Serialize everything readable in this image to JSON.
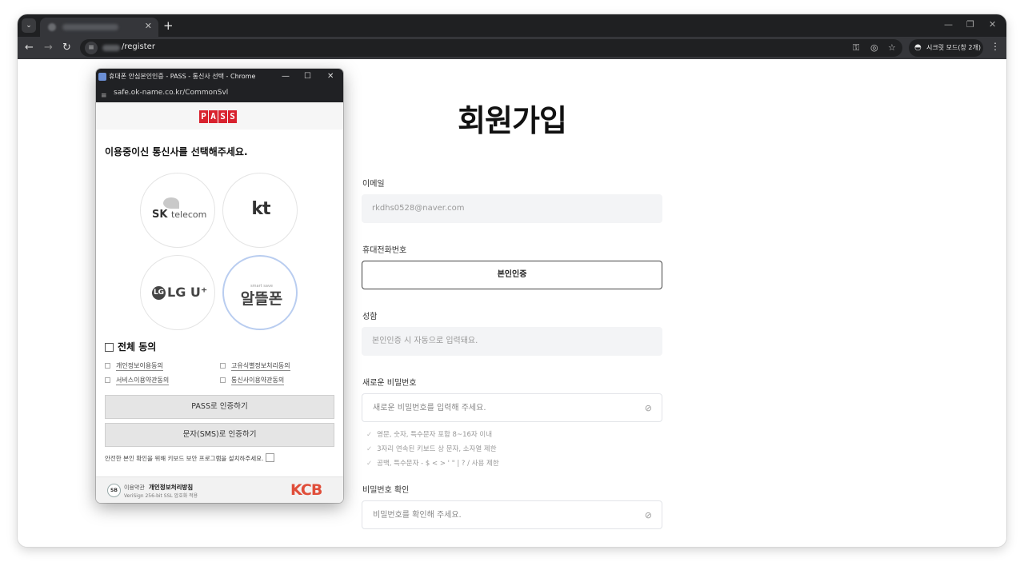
{
  "browser": {
    "tab_list_icon": "chevron-down-icon",
    "new_tab_label": "+",
    "window_controls": {
      "minimize": "—",
      "restore": "❐",
      "close": "✕"
    },
    "nav": {
      "back": "←",
      "forward": "→",
      "reload": "↻"
    },
    "address_path": "/register",
    "incognito_label": "시크릿 모드(창 2개)",
    "menu_label": "⋮"
  },
  "page": {
    "title": "회원가입",
    "fields": {
      "email": {
        "label": "이메일",
        "value": "rkdhs0528@naver.com"
      },
      "phone": {
        "label": "휴대전화번호",
        "button": "본인인증"
      },
      "name": {
        "label": "성함",
        "placeholder": "본인인증 시 자동으로 입력돼요."
      },
      "new_password": {
        "label": "새로운 비밀번호",
        "placeholder": "새로운 비밀번호를 입력해 주세요."
      },
      "confirm_password": {
        "label": "비밀번호 확인",
        "placeholder": "비밀번호를 확인해 주세요."
      }
    },
    "password_rules": [
      "영문, 숫자, 특수문자 포함 8~16자 이내",
      "3자리 연속된 키보드 상 문자, 소자열 제한",
      "공백, 특수문자 - $ < > ' \" | ? / 사용 제한"
    ]
  },
  "popup": {
    "window_title": "휴대폰 안심본인인증 - PASS - 통신사 선택 - Chrome",
    "window_controls": {
      "minimize": "—",
      "maximize": "☐",
      "close": "✕"
    },
    "url": "safe.ok-name.co.kr/CommonSvl",
    "logo_letters": [
      "P",
      "A",
      "S",
      "S"
    ],
    "heading": "이용중이신 통신사를 선택해주세요.",
    "carriers": {
      "skt": {
        "main": "SK",
        "sub": "telecom"
      },
      "kt": {
        "main": "kt"
      },
      "lgu": {
        "badge": "LG",
        "main": "LG U⁺"
      },
      "mvno": {
        "small": "smart save",
        "main": "알뜰폰"
      }
    },
    "agree_all": "전체 동의",
    "terms": [
      "개인정보이용동의",
      "고유식별정보처리동의",
      "서비스이용약관동의",
      "통신사이용약관동의"
    ],
    "buttons": {
      "pass_auth": "PASS로 인증하기",
      "sms_auth": "문자(SMS)로 인증하기"
    },
    "security_note": "안전한 본인 확인을 위해 키보드 보안 프로그램을 설치하주세요.",
    "footer": {
      "badge": "SB",
      "terms_link": "이용약관",
      "privacy_link": "개인정보처리방침",
      "ssl_note": "VeriSign 256-bit SSL 암호화 적용",
      "brand": "KCB"
    }
  }
}
